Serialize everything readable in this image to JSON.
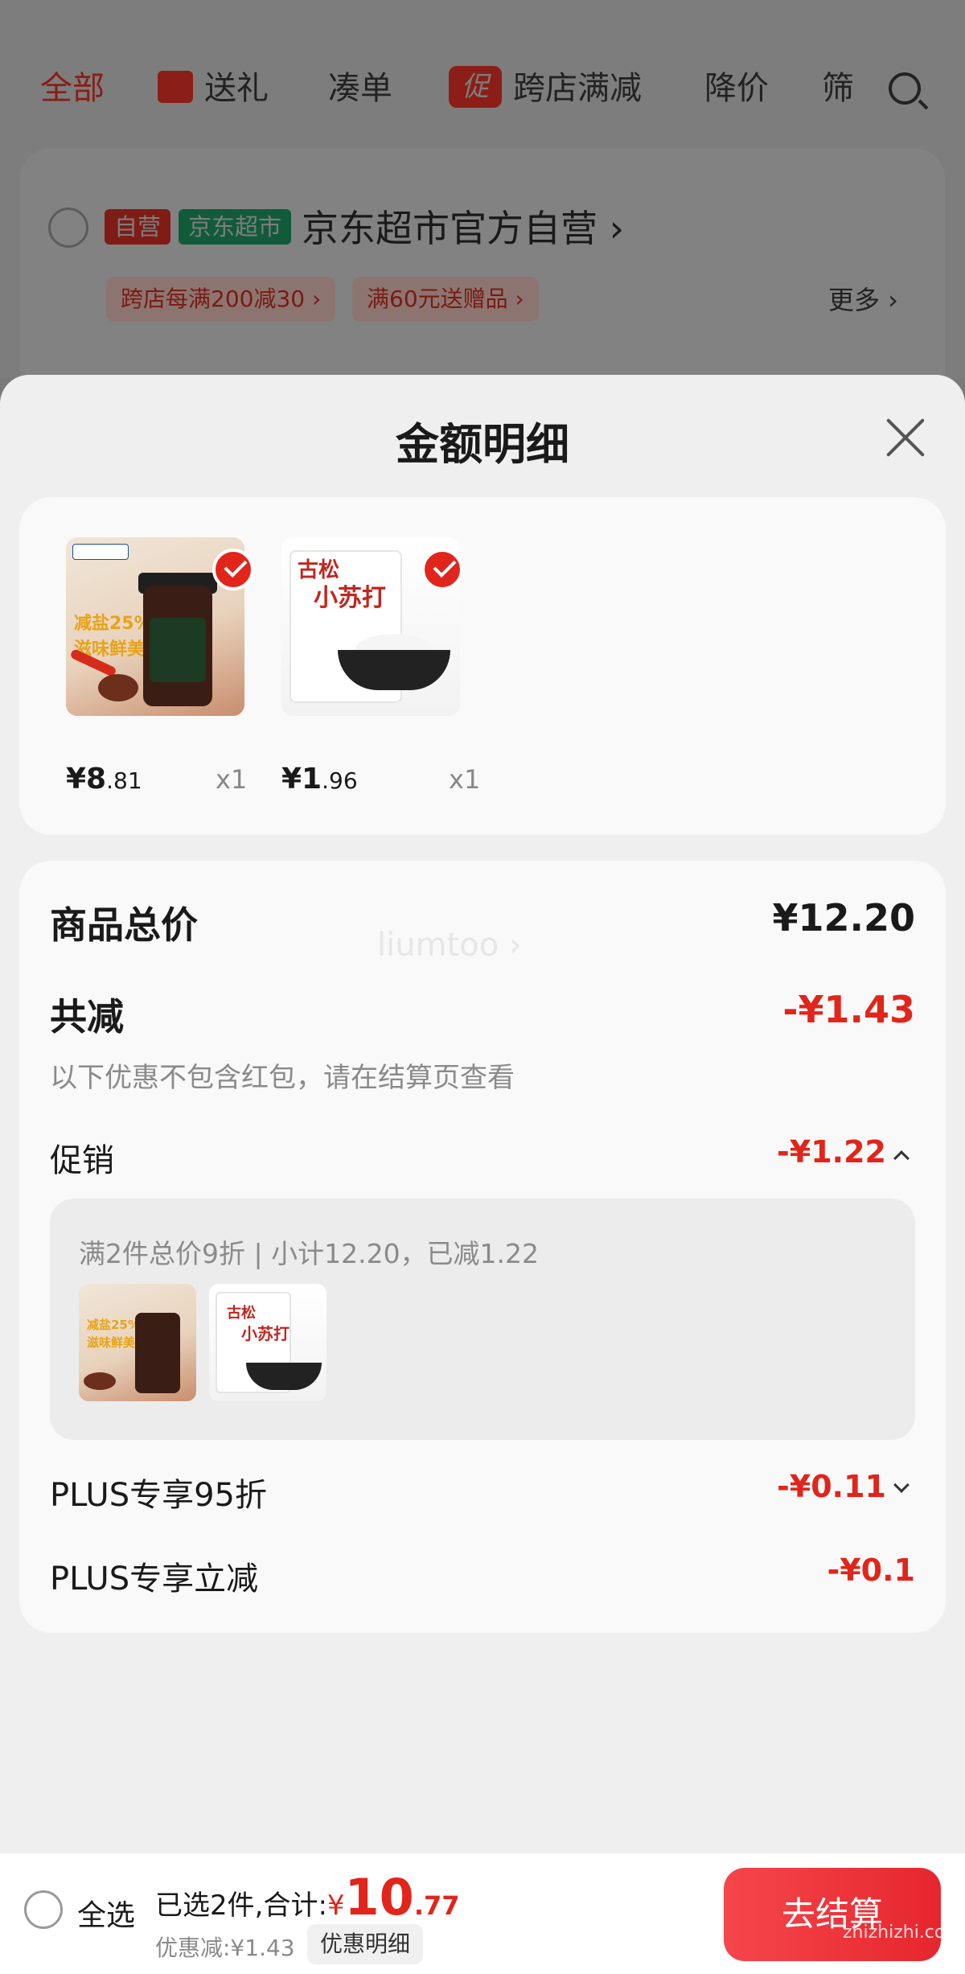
{
  "background": {
    "tabs": [
      "全部",
      "送礼",
      "凑单",
      "跨店满减",
      "降价",
      "筛"
    ],
    "promo_icon_text": "促",
    "shop": {
      "tag_self": "自营",
      "tag_market": "京东超市",
      "name": "京东超市官方自营 ›",
      "coupons": [
        "跨店每满200减30 ›",
        "满60元送赠品 ›"
      ],
      "more": "更多 ›"
    }
  },
  "sheet": {
    "title": "金额明细",
    "products": [
      {
        "price_int": "¥8",
        "price_dec": ".81",
        "qty": "x1",
        "banner": "减盐25%\n滋味鲜美"
      },
      {
        "price_int": "¥1",
        "price_dec": ".96",
        "qty": "x1",
        "bag_brand": "古松",
        "bag_title": "小苏打"
      }
    ],
    "total_label": "商品总价",
    "total_value": "¥12.20",
    "watermark": "liumtoo ›",
    "reduce_label": "共减",
    "reduce_value": "-¥1.43",
    "hint": "以下优惠不包含红包，请在结算页查看",
    "promo_label": "促销",
    "promo_value": "-¥1.22",
    "promo_desc": "满2件总价9折 | 小计12.20，已减1.22",
    "plus95_label": "PLUS专享95折",
    "plus95_value": "-¥0.11",
    "plus_cut_label": "PLUS专享立减",
    "plus_cut_value": "-¥0.1"
  },
  "bottom": {
    "select_all": "全选",
    "summary_prefix": "已选2件,合计:",
    "yen": "¥",
    "total_int": "10",
    "total_dec": ".77",
    "discount_text": "优惠减:¥1.43",
    "discount_detail_btn": "优惠明细",
    "checkout_btn": "去结算",
    "site_mark": "zhizhizhi.com"
  },
  "colors": {
    "accent_red": "#e1251b",
    "checkout_gradient": [
      "#f5464b",
      "#e6262e"
    ]
  }
}
